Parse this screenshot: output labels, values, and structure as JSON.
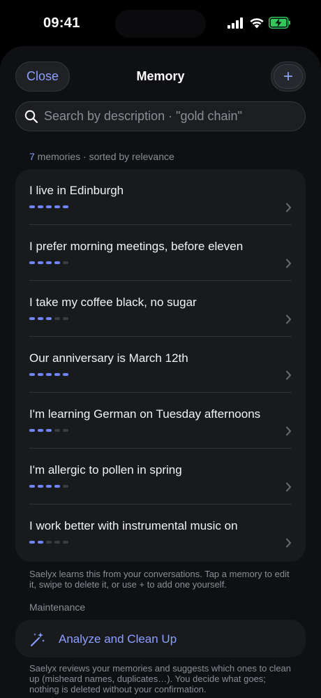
{
  "status_bar": {
    "time": "09:41"
  },
  "header": {
    "close_label": "Close",
    "title": "Memory",
    "add_label": "+"
  },
  "search": {
    "placeholder": "Search by description · \"gold chain\"",
    "value": ""
  },
  "summary": {
    "count": "7",
    "text": " memories · sorted by relevance"
  },
  "memories": [
    {
      "text": "I live in Edinburgh",
      "relevance": 5
    },
    {
      "text": "I prefer morning meetings, before eleven",
      "relevance": 4
    },
    {
      "text": "I take my coffee black, no sugar",
      "relevance": 3
    },
    {
      "text": "Our anniversary is March 12th",
      "relevance": 5
    },
    {
      "text": "I'm learning German on Tuesday afternoons",
      "relevance": 3
    },
    {
      "text": "I'm allergic to pollen in spring",
      "relevance": 4
    },
    {
      "text": "I work better with instrumental music on",
      "relevance": 2
    }
  ],
  "relevance_max": 5,
  "help_text": "Saelyx learns this from your conversations. Tap a memory to edit it, swipe to delete it, or use + to add one yourself.",
  "maintenance": {
    "section_label": "Maintenance",
    "analyze_label": "Analyze and Clean Up",
    "description": "Saelyx reviews your memories and suggests which ones to clean up (misheard names, duplicates…). You decide what goes; nothing is deleted without your confirmation."
  },
  "colors": {
    "accent": "#8da0ff",
    "dot_on": "#6f86ff",
    "dot_off": "#3a3d43",
    "battery": "#34c759"
  }
}
